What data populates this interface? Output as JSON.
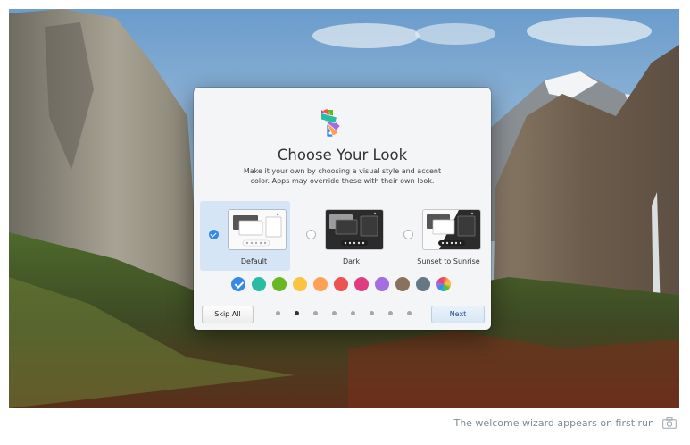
{
  "dialog": {
    "title": "Choose Your Look",
    "description": "Make it your own by choosing a visual style and accent color. Apps may override these with their own look.",
    "icon": "color-palette-icon",
    "styles": [
      {
        "label": "Default",
        "selected": true
      },
      {
        "label": "Dark",
        "selected": false
      },
      {
        "label": "Sunset to Sunrise",
        "selected": false
      }
    ],
    "accents": [
      {
        "name": "blueberry",
        "color": "#3689e6",
        "selected": true
      },
      {
        "name": "mint",
        "color": "#28bca3"
      },
      {
        "name": "lime",
        "color": "#68b723"
      },
      {
        "name": "banana",
        "color": "#f9c440"
      },
      {
        "name": "orange",
        "color": "#ffa154"
      },
      {
        "name": "strawberry",
        "color": "#ed5353"
      },
      {
        "name": "bubblegum",
        "color": "#de3e80"
      },
      {
        "name": "grape",
        "color": "#a56de2"
      },
      {
        "name": "cocoa",
        "color": "#8a715e"
      },
      {
        "name": "slate",
        "color": "#667885"
      },
      {
        "name": "auto",
        "color": "multicolor"
      }
    ],
    "skip_label": "Skip All",
    "next_label": "Next",
    "pages": 8,
    "current_page": 2
  },
  "caption": {
    "text": "The welcome wizard appears on first run",
    "icon": "camera-icon"
  }
}
